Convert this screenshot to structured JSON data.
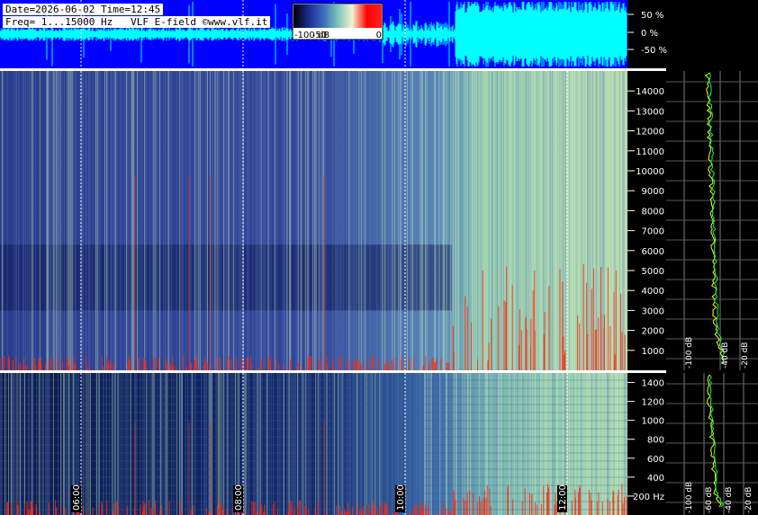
{
  "header": {
    "date_time": "Date=2026-06-02 Time=12:45",
    "freq_info": "Freq= 1...15000 Hz",
    "station": "VLF E-field ©www.vlf.it"
  },
  "colorbar": {
    "labels": [
      "-100 dB",
      "-50",
      "0"
    ],
    "colors": [
      "#000000",
      "#1a2a8a",
      "#3a68c0",
      "#7ac2b8",
      "#f2f4d0",
      "#ff0000",
      "#ff2020"
    ]
  },
  "waveform": {
    "labels": [
      "50 %",
      "0 %",
      "-50 %"
    ],
    "background": "#0000ff",
    "trace_color": "#00ffff"
  },
  "chart_data": [
    {
      "type": "heatmap",
      "name_hint": "spectrogram-full",
      "y_range": [
        0,
        15000
      ],
      "y_ticks": [
        1000,
        2000,
        3000,
        4000,
        5000,
        6000,
        7000,
        8000,
        9000,
        10000,
        11000,
        12000,
        13000,
        14000
      ]
    },
    {
      "type": "heatmap",
      "name_hint": "spectrogram-low",
      "y_range": [
        0,
        1500
      ],
      "y_ticks": [
        200,
        400,
        600,
        800,
        1000,
        1200,
        1400
      ],
      "y_tick_labels": [
        "200 Hz",
        "400",
        "600",
        "800",
        "1000",
        "1200",
        "1400"
      ],
      "time_labels": [
        "06:00",
        "08:00",
        "10:00",
        "12:00"
      ]
    },
    {
      "type": "line",
      "name_hint": "spectrum-full",
      "x_tick_labels": [
        "-100 dB",
        "-40 dB",
        "-20 dB"
      ]
    },
    {
      "type": "line",
      "name_hint": "spectrum-low",
      "x_tick_labels": [
        "-100 dB",
        "-60 dB",
        "-40 dB",
        "-20 dB"
      ]
    }
  ]
}
